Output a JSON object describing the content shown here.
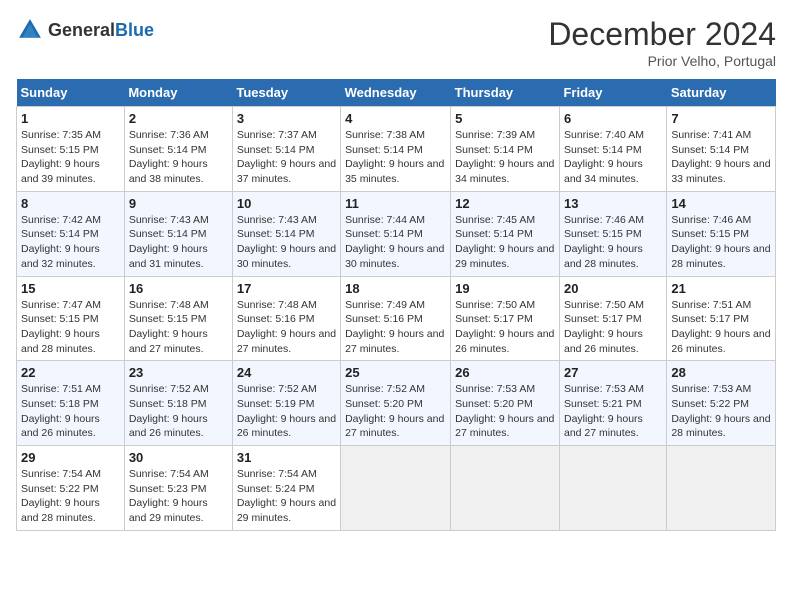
{
  "header": {
    "logo_general": "General",
    "logo_blue": "Blue",
    "month_title": "December 2024",
    "location": "Prior Velho, Portugal"
  },
  "days_of_week": [
    "Sunday",
    "Monday",
    "Tuesday",
    "Wednesday",
    "Thursday",
    "Friday",
    "Saturday"
  ],
  "weeks": [
    [
      {
        "day": "1",
        "sunrise": "Sunrise: 7:35 AM",
        "sunset": "Sunset: 5:15 PM",
        "daylight": "Daylight: 9 hours and 39 minutes."
      },
      {
        "day": "2",
        "sunrise": "Sunrise: 7:36 AM",
        "sunset": "Sunset: 5:14 PM",
        "daylight": "Daylight: 9 hours and 38 minutes."
      },
      {
        "day": "3",
        "sunrise": "Sunrise: 7:37 AM",
        "sunset": "Sunset: 5:14 PM",
        "daylight": "Daylight: 9 hours and 37 minutes."
      },
      {
        "day": "4",
        "sunrise": "Sunrise: 7:38 AM",
        "sunset": "Sunset: 5:14 PM",
        "daylight": "Daylight: 9 hours and 35 minutes."
      },
      {
        "day": "5",
        "sunrise": "Sunrise: 7:39 AM",
        "sunset": "Sunset: 5:14 PM",
        "daylight": "Daylight: 9 hours and 34 minutes."
      },
      {
        "day": "6",
        "sunrise": "Sunrise: 7:40 AM",
        "sunset": "Sunset: 5:14 PM",
        "daylight": "Daylight: 9 hours and 34 minutes."
      },
      {
        "day": "7",
        "sunrise": "Sunrise: 7:41 AM",
        "sunset": "Sunset: 5:14 PM",
        "daylight": "Daylight: 9 hours and 33 minutes."
      }
    ],
    [
      {
        "day": "8",
        "sunrise": "Sunrise: 7:42 AM",
        "sunset": "Sunset: 5:14 PM",
        "daylight": "Daylight: 9 hours and 32 minutes."
      },
      {
        "day": "9",
        "sunrise": "Sunrise: 7:43 AM",
        "sunset": "Sunset: 5:14 PM",
        "daylight": "Daylight: 9 hours and 31 minutes."
      },
      {
        "day": "10",
        "sunrise": "Sunrise: 7:43 AM",
        "sunset": "Sunset: 5:14 PM",
        "daylight": "Daylight: 9 hours and 30 minutes."
      },
      {
        "day": "11",
        "sunrise": "Sunrise: 7:44 AM",
        "sunset": "Sunset: 5:14 PM",
        "daylight": "Daylight: 9 hours and 30 minutes."
      },
      {
        "day": "12",
        "sunrise": "Sunrise: 7:45 AM",
        "sunset": "Sunset: 5:14 PM",
        "daylight": "Daylight: 9 hours and 29 minutes."
      },
      {
        "day": "13",
        "sunrise": "Sunrise: 7:46 AM",
        "sunset": "Sunset: 5:15 PM",
        "daylight": "Daylight: 9 hours and 28 minutes."
      },
      {
        "day": "14",
        "sunrise": "Sunrise: 7:46 AM",
        "sunset": "Sunset: 5:15 PM",
        "daylight": "Daylight: 9 hours and 28 minutes."
      }
    ],
    [
      {
        "day": "15",
        "sunrise": "Sunrise: 7:47 AM",
        "sunset": "Sunset: 5:15 PM",
        "daylight": "Daylight: 9 hours and 28 minutes."
      },
      {
        "day": "16",
        "sunrise": "Sunrise: 7:48 AM",
        "sunset": "Sunset: 5:15 PM",
        "daylight": "Daylight: 9 hours and 27 minutes."
      },
      {
        "day": "17",
        "sunrise": "Sunrise: 7:48 AM",
        "sunset": "Sunset: 5:16 PM",
        "daylight": "Daylight: 9 hours and 27 minutes."
      },
      {
        "day": "18",
        "sunrise": "Sunrise: 7:49 AM",
        "sunset": "Sunset: 5:16 PM",
        "daylight": "Daylight: 9 hours and 27 minutes."
      },
      {
        "day": "19",
        "sunrise": "Sunrise: 7:50 AM",
        "sunset": "Sunset: 5:17 PM",
        "daylight": "Daylight: 9 hours and 26 minutes."
      },
      {
        "day": "20",
        "sunrise": "Sunrise: 7:50 AM",
        "sunset": "Sunset: 5:17 PM",
        "daylight": "Daylight: 9 hours and 26 minutes."
      },
      {
        "day": "21",
        "sunrise": "Sunrise: 7:51 AM",
        "sunset": "Sunset: 5:17 PM",
        "daylight": "Daylight: 9 hours and 26 minutes."
      }
    ],
    [
      {
        "day": "22",
        "sunrise": "Sunrise: 7:51 AM",
        "sunset": "Sunset: 5:18 PM",
        "daylight": "Daylight: 9 hours and 26 minutes."
      },
      {
        "day": "23",
        "sunrise": "Sunrise: 7:52 AM",
        "sunset": "Sunset: 5:18 PM",
        "daylight": "Daylight: 9 hours and 26 minutes."
      },
      {
        "day": "24",
        "sunrise": "Sunrise: 7:52 AM",
        "sunset": "Sunset: 5:19 PM",
        "daylight": "Daylight: 9 hours and 26 minutes."
      },
      {
        "day": "25",
        "sunrise": "Sunrise: 7:52 AM",
        "sunset": "Sunset: 5:20 PM",
        "daylight": "Daylight: 9 hours and 27 minutes."
      },
      {
        "day": "26",
        "sunrise": "Sunrise: 7:53 AM",
        "sunset": "Sunset: 5:20 PM",
        "daylight": "Daylight: 9 hours and 27 minutes."
      },
      {
        "day": "27",
        "sunrise": "Sunrise: 7:53 AM",
        "sunset": "Sunset: 5:21 PM",
        "daylight": "Daylight: 9 hours and 27 minutes."
      },
      {
        "day": "28",
        "sunrise": "Sunrise: 7:53 AM",
        "sunset": "Sunset: 5:22 PM",
        "daylight": "Daylight: 9 hours and 28 minutes."
      }
    ],
    [
      {
        "day": "29",
        "sunrise": "Sunrise: 7:54 AM",
        "sunset": "Sunset: 5:22 PM",
        "daylight": "Daylight: 9 hours and 28 minutes."
      },
      {
        "day": "30",
        "sunrise": "Sunrise: 7:54 AM",
        "sunset": "Sunset: 5:23 PM",
        "daylight": "Daylight: 9 hours and 29 minutes."
      },
      {
        "day": "31",
        "sunrise": "Sunrise: 7:54 AM",
        "sunset": "Sunset: 5:24 PM",
        "daylight": "Daylight: 9 hours and 29 minutes."
      },
      null,
      null,
      null,
      null
    ]
  ]
}
